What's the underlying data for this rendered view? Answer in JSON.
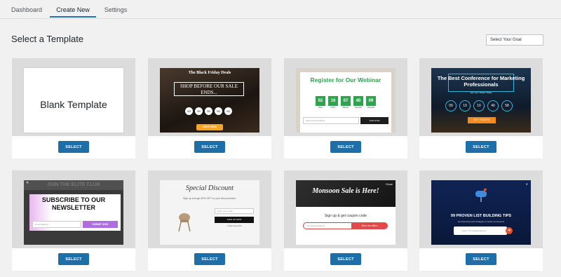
{
  "tabs": [
    {
      "label": "Dashboard"
    },
    {
      "label": "Create New",
      "active": true
    },
    {
      "label": "Settings"
    }
  ],
  "page_title": "Select a Template",
  "goal_select": {
    "value": "Select Your Goal"
  },
  "select_label": "SELECT",
  "templates": [
    {
      "name": "blank",
      "title": "Blank Template"
    },
    {
      "name": "black-friday",
      "title": "The Black Friday Deals",
      "headline": "SHOP BEFORE OUR SALE ENDS...",
      "timer": [
        "00",
        "00",
        "00",
        "00",
        "00"
      ],
      "cta": "SHOP NOW"
    },
    {
      "name": "webinar",
      "title": "Register for Our Webinar",
      "timer": [
        "02",
        "16",
        "07",
        "40",
        "09"
      ],
      "timer_labels": [
        "Days",
        "Hours",
        "Minutes",
        "Seconds",
        "Seconds"
      ],
      "field": "Enter Email Address",
      "cta": "JOIN NOW"
    },
    {
      "name": "conference",
      "title": "The Best Conference for Marketing Professionals",
      "subtitle": "Get Your Tickets Today",
      "timer": [
        "09",
        "19",
        "10",
        "40",
        "58"
      ],
      "cta": "BUY TICKETS"
    },
    {
      "name": "newsletter",
      "banner": "JOIN THE ELITE CLUB",
      "title": "SUBSCRIBE TO OUR NEWSLETTER",
      "field": "Email address",
      "cta": "SUBMIT NOW"
    },
    {
      "name": "special-discount",
      "title": "Special Discount",
      "subtitle": "Sign up and get 30% OFF on your first purchase.",
      "field": "Enter your email",
      "cta": "SIGN UP NOW",
      "note": "Crafted space FMI"
    },
    {
      "name": "monsoon",
      "close": "Close",
      "title": "Monsoon Sale is Here!",
      "subtitle": "Sign up & get coupon code",
      "field": "Your Email Address",
      "cta": "Give me offers"
    },
    {
      "name": "list-building",
      "title": "99 PROVEN LIST BUILDING TIPS",
      "subtitle": "Get latest tips and strategies to boost conversions",
      "field": "Enter Your Email Address"
    }
  ],
  "colors": {
    "accent": "#2271b1",
    "button": "#1e6fa8",
    "card_bg": "#dcdcdc",
    "page_bg": "#f1f1f1"
  }
}
